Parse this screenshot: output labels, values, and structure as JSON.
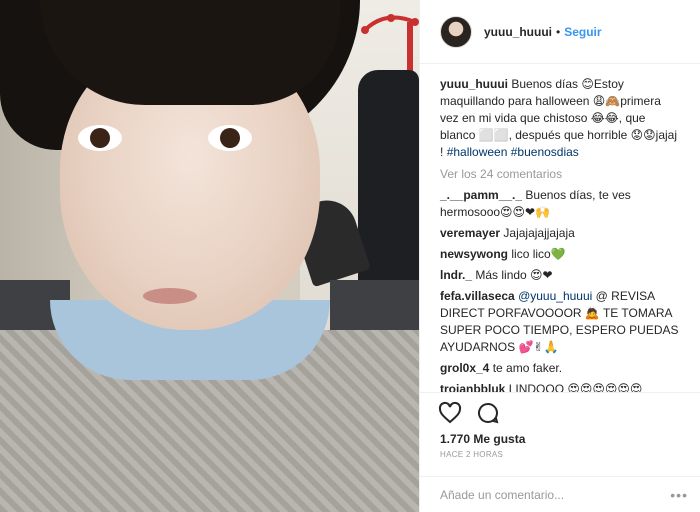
{
  "header": {
    "username": "yuuu_huuui",
    "separator": "•",
    "follow_label": "Seguir"
  },
  "caption": {
    "username": "yuuu_huuui",
    "text": "Buenos días 😊Estoy maquillando para halloween 😩🙈primera vez en mi vida que chistoso 😂😂, que blanco ⬜⬜, después que horrible 😟😟jajaj !",
    "hashtags": [
      "#halloween",
      "#buenosdias"
    ]
  },
  "view_comments_label": "Ver los 24 comentarios",
  "comments": [
    {
      "user": "_.__pamm__._",
      "text": "Buenos días, te ves hermosooo😍😍❤🙌"
    },
    {
      "user": "veremayer",
      "text": "Jajajajajjajaja"
    },
    {
      "user": "newsywong",
      "text": "lico lico💚"
    },
    {
      "user": "lndr._",
      "text": "Más lindo 😍❤"
    },
    {
      "user": "fefa.villaseca",
      "mention": "@yuuu_huuui",
      "text": "@ REVISA DIRECT PORFAVOOOOR 🙇 TE TOMARA SUPER POCO TIEMPO, ESPERO PUEDAS AYUDARNOS 💕✌🙏"
    },
    {
      "user": "grol0x_4",
      "text": "te amo faker."
    },
    {
      "user": "troianbbluk",
      "text": "LINDOOO 😍😍😍😍😍😍"
    }
  ],
  "likes": "1.770 Me gusta",
  "timestamp": "HACE 2 HORAS",
  "add_comment_placeholder": "Añade un comentario...",
  "more_options": "•••",
  "icons": {
    "like": "heart-icon",
    "comment": "comment-bubble-icon"
  }
}
